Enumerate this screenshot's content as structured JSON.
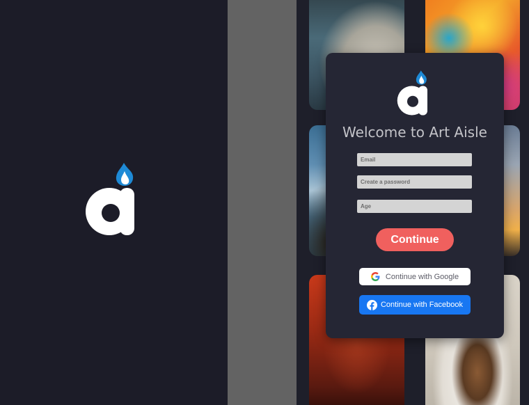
{
  "left_panel": {
    "logo_icon": "art-aisle-logo-icon"
  },
  "gallery": {
    "tiles": [
      {
        "subject": "turtles on a rock in water"
      },
      {
        "subject": "colorful abstract painting"
      },
      {
        "subject": "rocky shoreline with waves"
      },
      {
        "subject": "sunset sky over pier"
      },
      {
        "subject": "red-lit room with frames"
      },
      {
        "subject": "bowl of granola and fruit"
      }
    ]
  },
  "signup_card": {
    "logo_icon": "art-aisle-logo-icon",
    "title": "Welcome to Art Aisle",
    "email_placeholder": "Email",
    "password_placeholder": "Create a password",
    "age_placeholder": "Age",
    "continue_label": "Continue",
    "google_label": "Continue with Google",
    "google_icon": "google-g-icon",
    "facebook_label": "Continue with Facebook",
    "facebook_icon": "facebook-icon"
  },
  "colors": {
    "background": "#1c1c28",
    "card": "#252634",
    "continue": "#f0605e",
    "facebook": "#1877f2",
    "logo_flame": "#1e8ad6"
  }
}
